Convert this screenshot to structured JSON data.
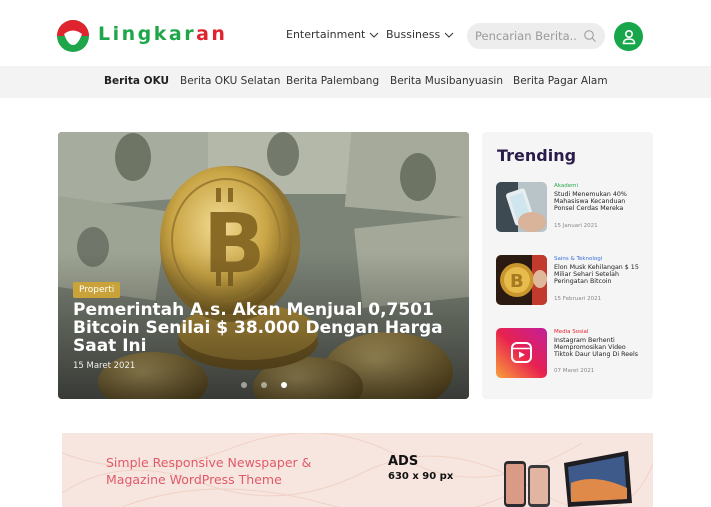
{
  "header": {
    "brand_main": "Lingkar",
    "brand_accent": "an",
    "menu": [
      {
        "label": "Entertainment"
      },
      {
        "label": "Bussiness"
      }
    ],
    "search_placeholder": "Pencarian Berita.."
  },
  "categories": [
    "Berita OKU",
    "Berita OKU Selatan",
    "Berita Palembang",
    "Berita Musibanyuasin",
    "Berita Pagar Alam"
  ],
  "hero": {
    "badge": "Properti",
    "title": "Pemerintah A.s. Akan Menjual 0,7501 Bitcoin Senilai $ 38.000 Dengan Harga Saat Ini",
    "date": "15 Maret 2021",
    "slide_count": 3,
    "active_slide": 3
  },
  "trending": {
    "title": "Trending",
    "items": [
      {
        "category": "Akademi",
        "category_color": "#2aa84a",
        "headline": "Studi Menemukan 40% Mahasiswa Kecanduan Ponsel Cerdas Mereka",
        "date": "15 Januari 2021"
      },
      {
        "category": "Sains & Teknologi",
        "category_color": "#3b6fd8",
        "headline": "Elon Musk Kehilangan $ 15 Miliar Sehari Setelah Peringatan Bitcoin",
        "date": "15 Februari 2021"
      },
      {
        "category": "Media Sosial",
        "category_color": "#e0242f",
        "headline": "Instagram Berhenti Mempromosikan Video Tiktok Daur Ulang Di Reels",
        "date": "07 Maret 2021"
      }
    ]
  },
  "ad": {
    "text": "Simple Responsive Newspaper & Magazine WordPress Theme",
    "title": "ADS",
    "size": "630 x 90 px"
  },
  "colors": {
    "brand_green": "#1fa64a",
    "brand_red": "#e0242f",
    "badge_gold": "#c9a23a",
    "trending_title": "#2a1d4a"
  }
}
